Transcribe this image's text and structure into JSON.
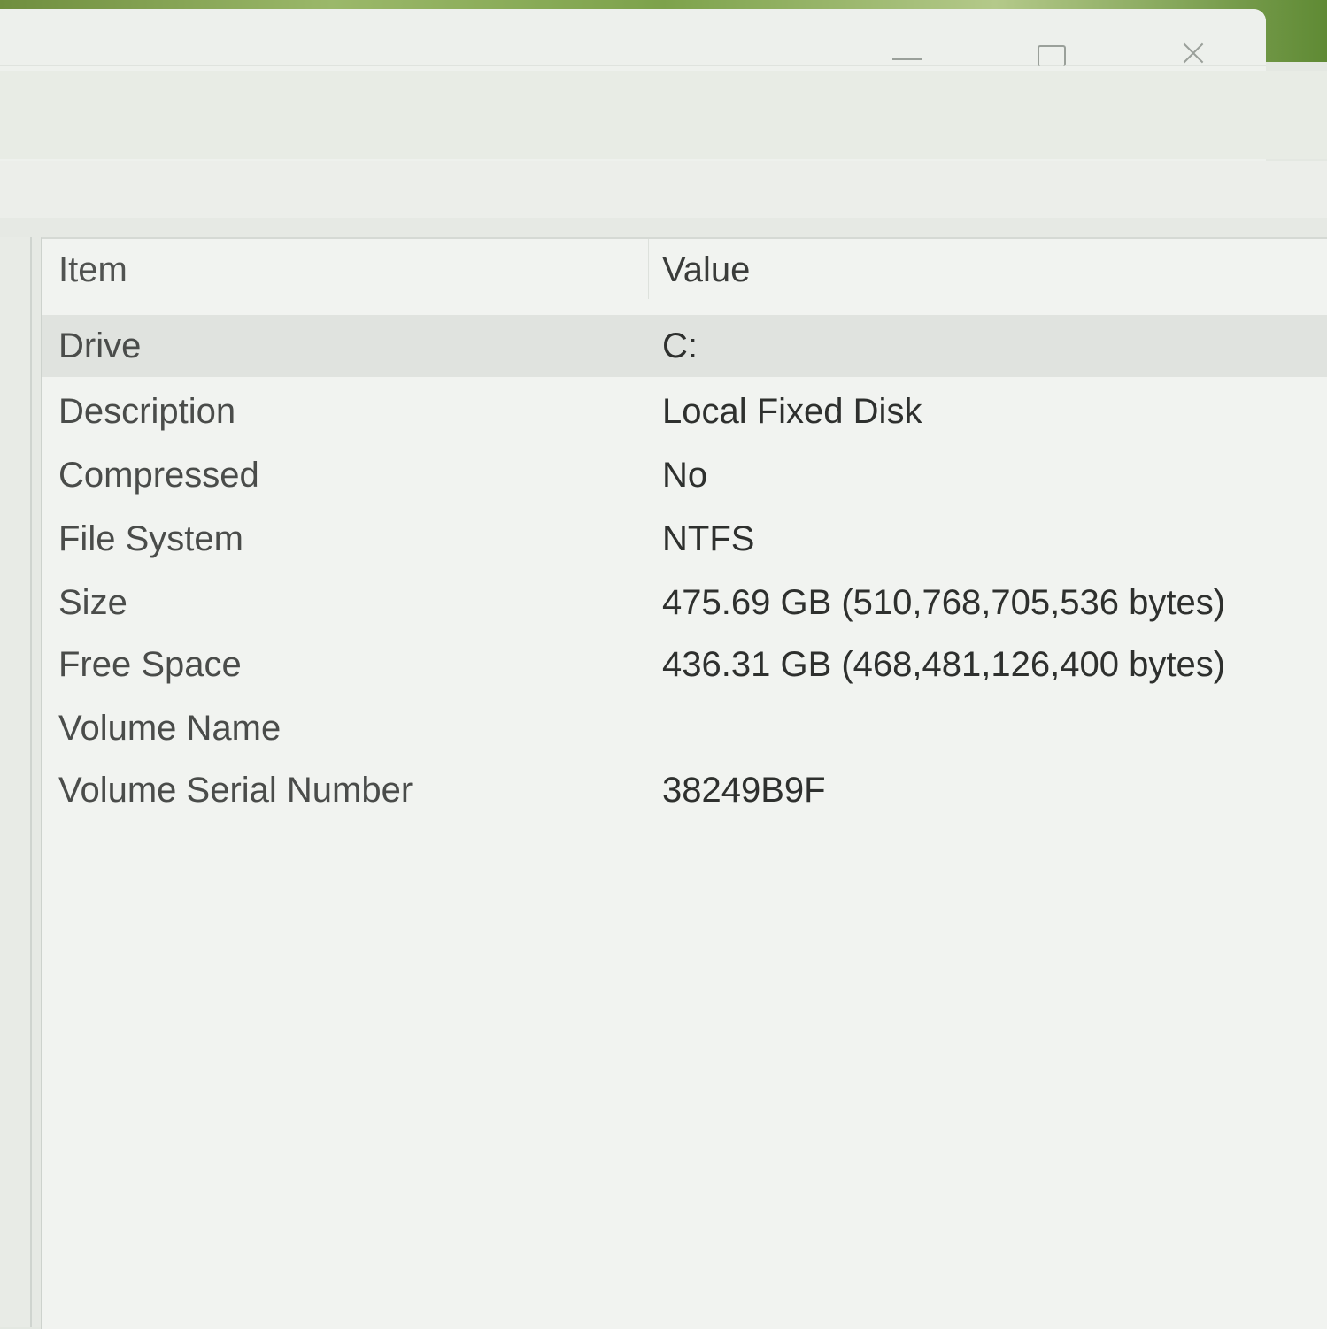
{
  "window": {
    "controls": {
      "minimize_icon": "minimize-icon",
      "maximize_icon": "maximize-icon",
      "close_icon": "close-icon"
    }
  },
  "table": {
    "headers": [
      "Item",
      "Value"
    ],
    "rows": [
      {
        "item": "Drive",
        "value": "C:"
      },
      {
        "item": "Description",
        "value": "Local Fixed Disk"
      },
      {
        "item": "Compressed",
        "value": "No"
      },
      {
        "item": "File System",
        "value": "NTFS"
      },
      {
        "item": "Size",
        "value": "475.69 GB (510,768,705,536 bytes)"
      },
      {
        "item": "Free Space",
        "value": "436.31 GB (468,481,126,400 bytes)"
      },
      {
        "item": "Volume Name",
        "value": ""
      },
      {
        "item": "Volume Serial Number",
        "value": "38249B9F"
      }
    ],
    "selected_row": 0
  }
}
